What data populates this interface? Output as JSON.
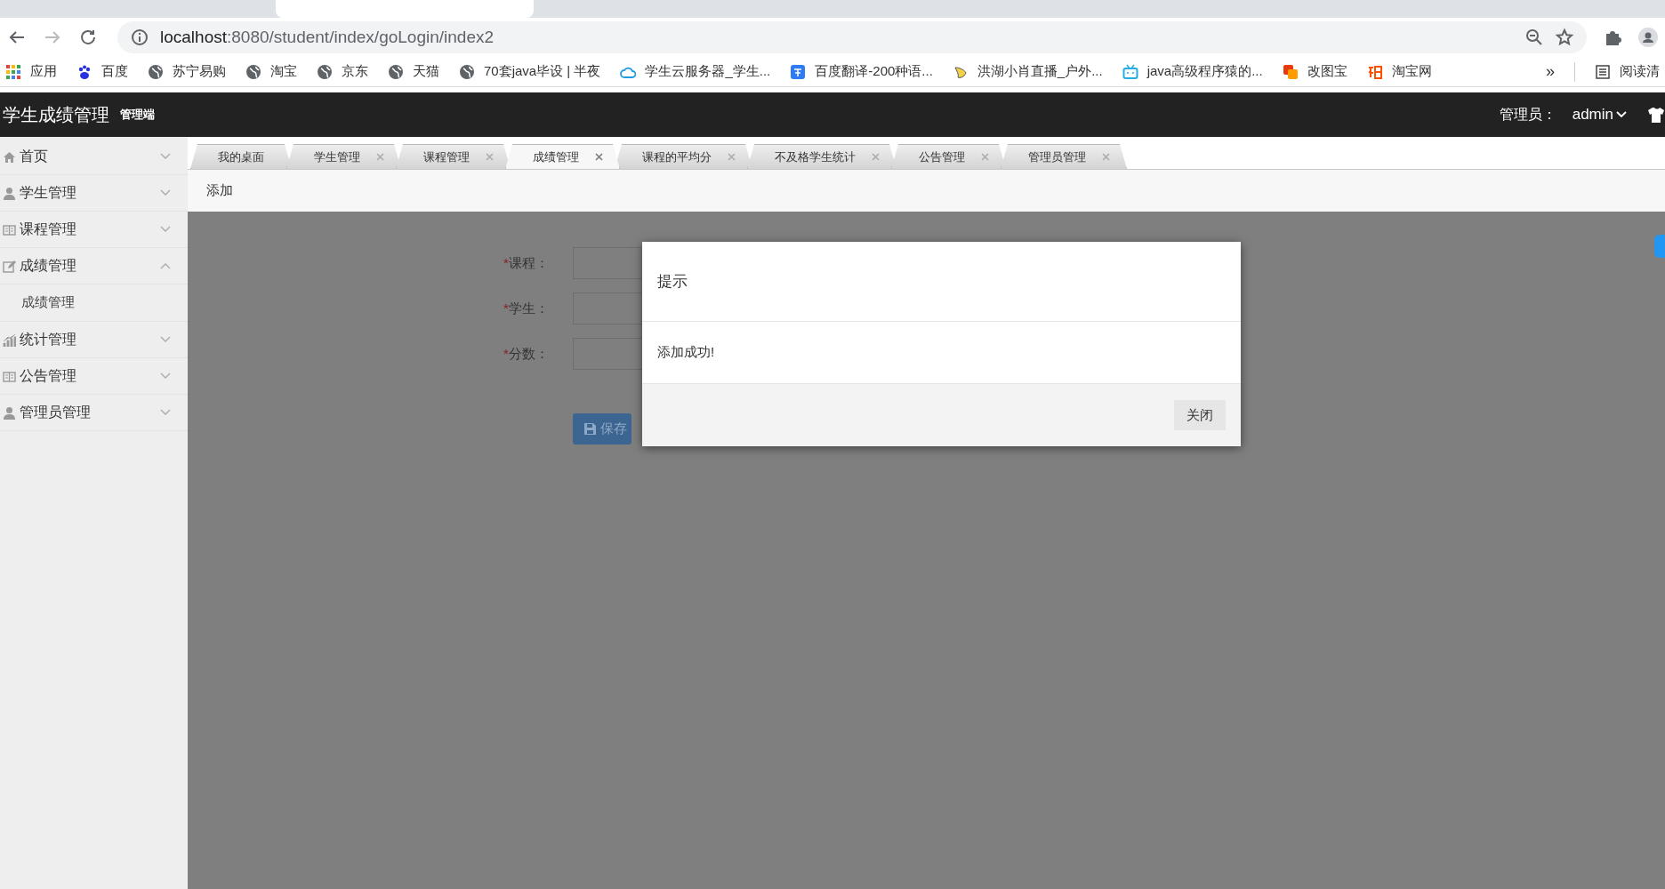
{
  "browser": {
    "address": {
      "host": "localhost",
      "path": ":8080/student/index/goLogin/index2"
    },
    "bookmarks": [
      {
        "kind": "apps",
        "label": "应用"
      },
      {
        "kind": "paw",
        "label": "百度"
      },
      {
        "kind": "globe",
        "label": "苏宁易购"
      },
      {
        "kind": "globe",
        "label": "淘宝"
      },
      {
        "kind": "globe",
        "label": "京东"
      },
      {
        "kind": "globe",
        "label": "天猫"
      },
      {
        "kind": "globe",
        "label": "70套java毕设 | 半夜"
      },
      {
        "kind": "cloud",
        "label": "学生云服务器_学生..."
      },
      {
        "kind": "translate",
        "label": "百度翻译-200种语..."
      },
      {
        "kind": "bird",
        "label": "洪湖小肖直播_户外..."
      },
      {
        "kind": "tv",
        "label": "java高级程序猿的..."
      },
      {
        "kind": "squares",
        "label": "改图宝"
      },
      {
        "kind": "tao",
        "label": "淘宝网"
      }
    ],
    "more": "»",
    "reading_list": "阅读清"
  },
  "header": {
    "title": "学生成绩管理",
    "subtitle": "管理端",
    "user_label": "管理员：",
    "user": "admin"
  },
  "sidebar": {
    "items": [
      {
        "kind": "home",
        "label": "首页",
        "expanded": false
      },
      {
        "kind": "user",
        "label": "学生管理",
        "expanded": false
      },
      {
        "kind": "grid",
        "label": "课程管理",
        "expanded": false
      },
      {
        "kind": "edit",
        "label": "成绩管理",
        "expanded": true,
        "children": [
          {
            "label": "成绩管理"
          }
        ]
      },
      {
        "kind": "chart",
        "label": "统计管理",
        "expanded": false
      },
      {
        "kind": "grid",
        "label": "公告管理",
        "expanded": false
      },
      {
        "kind": "user",
        "label": "管理员管理",
        "expanded": false
      }
    ]
  },
  "tabs": [
    {
      "label": "我的桌面",
      "closable": false,
      "selected": false
    },
    {
      "label": "学生管理",
      "closable": true,
      "selected": false
    },
    {
      "label": "课程管理",
      "closable": true,
      "selected": false
    },
    {
      "label": "成绩管理",
      "closable": true,
      "selected": true
    },
    {
      "label": "课程的平均分",
      "closable": true,
      "selected": false
    },
    {
      "label": "不及格学生统计",
      "closable": true,
      "selected": false
    },
    {
      "label": "公告管理",
      "closable": true,
      "selected": false
    },
    {
      "label": "管理员管理",
      "closable": true,
      "selected": false
    }
  ],
  "toolbar": {
    "label": "添加"
  },
  "form": {
    "fields": [
      {
        "mark": "*",
        "label": "课程："
      },
      {
        "mark": "*",
        "label": "学生："
      },
      {
        "mark": "*",
        "label": "分数："
      }
    ],
    "save": "保存"
  },
  "dialog": {
    "title": "提示",
    "message": "添加成功!",
    "button": "关闭"
  }
}
